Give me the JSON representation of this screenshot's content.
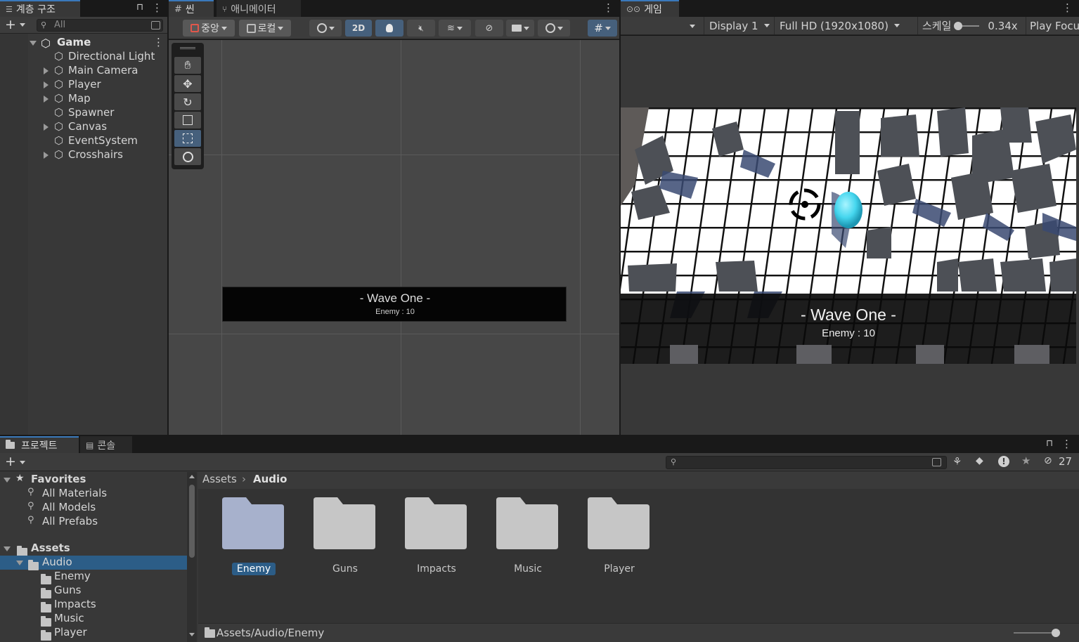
{
  "hierarchy": {
    "tab_label": "계층 구조",
    "search_placeholder": "All",
    "scene_name": "Game",
    "items": [
      {
        "label": "Directional Light",
        "expandable": false
      },
      {
        "label": "Main Camera",
        "expandable": true
      },
      {
        "label": "Player",
        "expandable": true
      },
      {
        "label": "Map",
        "expandable": true
      },
      {
        "label": "Spawner",
        "expandable": false
      },
      {
        "label": "Canvas",
        "expandable": true
      },
      {
        "label": "EventSystem",
        "expandable": false
      },
      {
        "label": "Crosshairs",
        "expandable": true
      }
    ]
  },
  "scene": {
    "tab_label": "씬",
    "animator_tab_label": "애니메이터",
    "pivot_label": "중앙",
    "space_label": "로컬",
    "mode_2d_label": "2D",
    "canvas_title": "- Wave One -",
    "canvas_subtitle": "Enemy : 10"
  },
  "game": {
    "tab_label": "게임",
    "display_label": "Display 1",
    "resolution_label": "Full HD (1920x1080)",
    "scale_label": "스케일",
    "scale_value": "0.34x",
    "play_focus_label": "Play Focu",
    "wave_title": "- Wave One -",
    "wave_subtitle": "Enemy : 10"
  },
  "project": {
    "tab_label": "프로젝트",
    "console_tab_label": "콘솔",
    "hidden_count": "27",
    "favorites_label": "Favorites",
    "favorites": [
      "All Materials",
      "All Models",
      "All Prefabs"
    ],
    "assets_label": "Assets",
    "audio_label": "Audio",
    "audio_children": [
      "Enemy",
      "Guns",
      "Impacts",
      "Music",
      "Player"
    ],
    "breadcrumb_root": "Assets",
    "breadcrumb_current": "Audio",
    "folders": [
      "Enemy",
      "Guns",
      "Impacts",
      "Music",
      "Player"
    ],
    "selected_folder": "Enemy",
    "status_path": "Assets/Audio/Enemy"
  },
  "colors": {
    "accent": "#3a79bb",
    "selection": "#2c5d87",
    "panel": "#383838",
    "scene_bg": "#474747",
    "player_cyan": "#45d6ee"
  }
}
